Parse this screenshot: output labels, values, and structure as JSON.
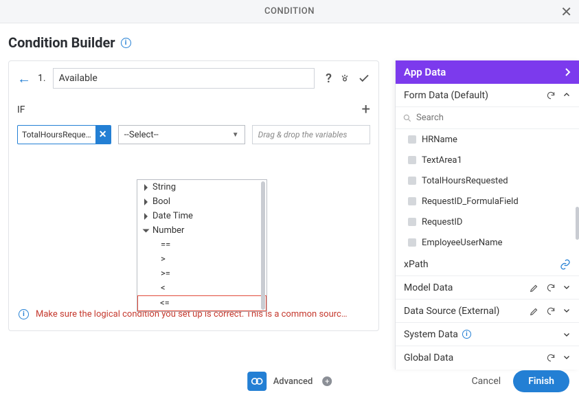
{
  "topbar": {
    "title": "CONDITION"
  },
  "pageTitle": "Condition Builder",
  "builder": {
    "index": "1.",
    "name": "Available",
    "ifLabel": "IF",
    "token": "TotalHoursReque…",
    "selectPlaceholder": "--Select--",
    "dropTargetPlaceholder": "Drag & drop the variables",
    "dropdown": {
      "groups": [
        "String",
        "Bool",
        "Date Time",
        "Number"
      ],
      "openGroup": "Number",
      "operators": [
        "==",
        ">",
        ">=",
        "<",
        "<="
      ],
      "highlight": "<="
    }
  },
  "warning": "Make sure the logical condition you set up is correct. This is a common sourc…",
  "rightPanel": {
    "header": "App Data",
    "sections": {
      "formData": {
        "label": "Form Data (Default)",
        "searchPlaceholder": "Search",
        "fields": [
          "HRName",
          "TextArea1",
          "TotalHoursRequested",
          "RequestID_FormulaField",
          "RequestID",
          "EmployeeUserName"
        ]
      },
      "xpath": {
        "label": "xPath"
      },
      "modelData": {
        "label": "Model Data"
      },
      "dataSource": {
        "label": "Data Source (External)"
      },
      "systemData": {
        "label": "System Data"
      },
      "globalData": {
        "label": "Global Data"
      }
    }
  },
  "footer": {
    "advanced": "Advanced",
    "cancel": "Cancel",
    "finish": "Finish"
  }
}
